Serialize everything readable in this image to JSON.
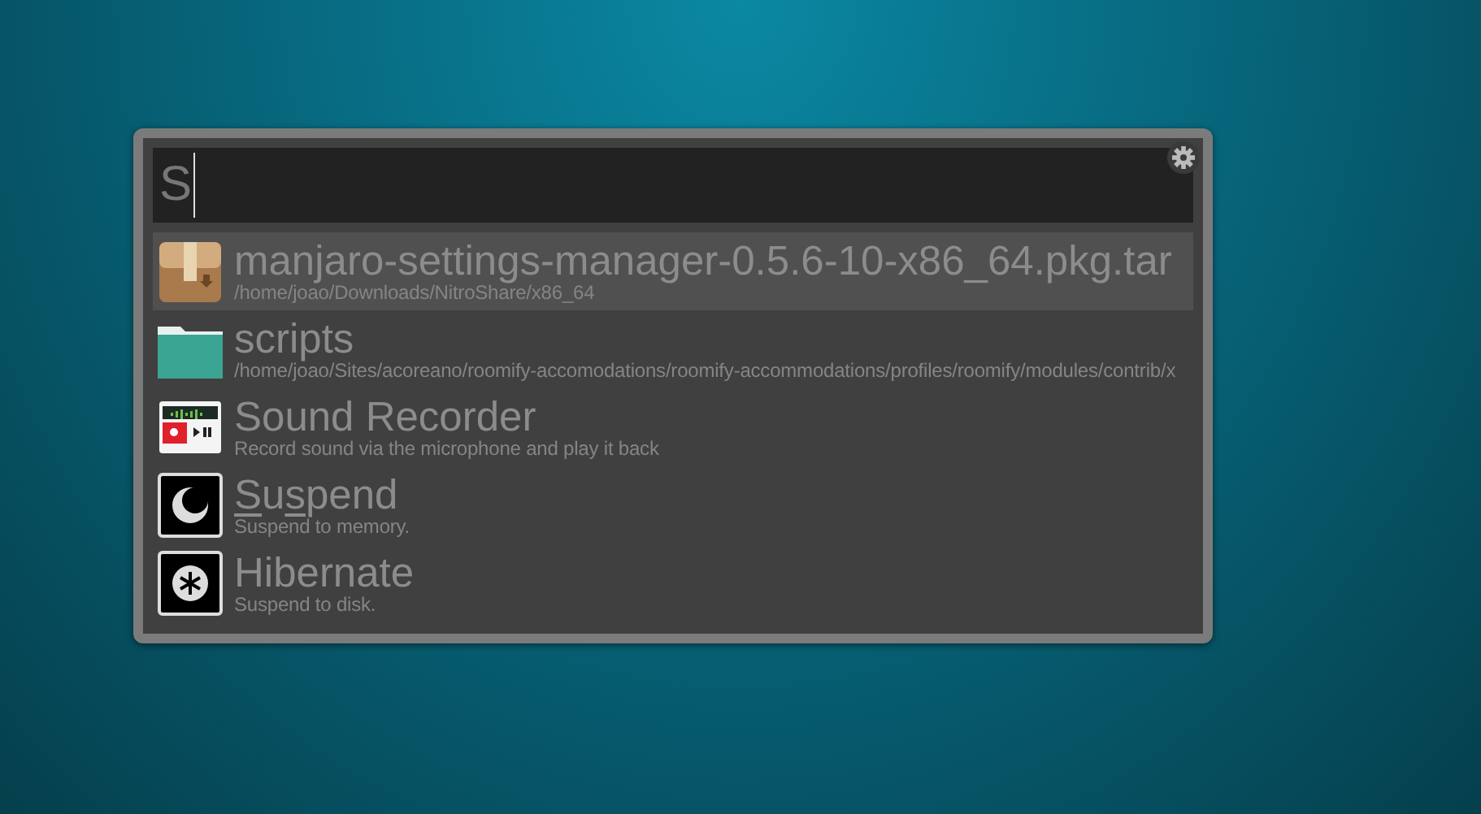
{
  "search": {
    "value": "S"
  },
  "results": [
    {
      "kind": "package",
      "selected": true,
      "title": [
        {
          "text": "manjaro-settings-manager-0.5.6-10-x86_64.pkg.tar",
          "matched": false
        }
      ],
      "subtitle": "/home/joao/Downloads/NitroShare/x86_64"
    },
    {
      "kind": "folder",
      "selected": false,
      "title": [
        {
          "text": "scripts",
          "matched": false
        }
      ],
      "subtitle": "/home/joao/Sites/acoreano/roomify-accomodations/roomify-accommodations/profiles/roomify/modules/contrib/x"
    },
    {
      "kind": "recorder",
      "selected": false,
      "title": [
        {
          "text": "Sound Recorder",
          "matched": false
        }
      ],
      "subtitle": "Record sound via the microphone and play it back"
    },
    {
      "kind": "moon",
      "selected": false,
      "title": [
        {
          "text": "S",
          "matched": true
        },
        {
          "text": "u",
          "matched": false
        },
        {
          "text": "s",
          "matched": true
        },
        {
          "text": "pend",
          "matched": false
        }
      ],
      "subtitle": "Suspend to memory."
    },
    {
      "kind": "snow",
      "selected": false,
      "title": [
        {
          "text": "Hibernate",
          "matched": false
        }
      ],
      "subtitle": "Suspend to disk."
    }
  ]
}
